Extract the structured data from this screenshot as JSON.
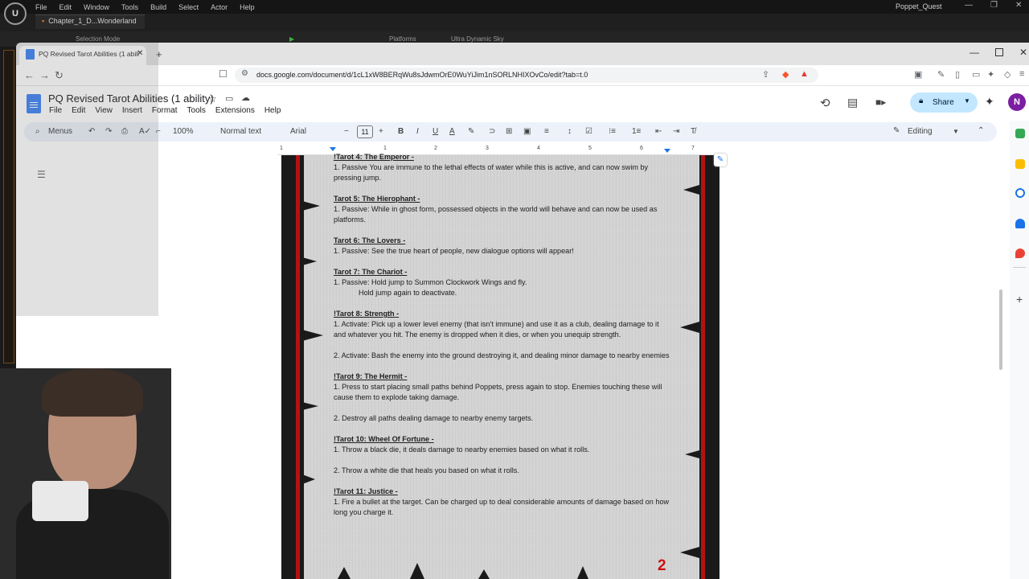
{
  "unreal": {
    "logo": "U",
    "menu": [
      "File",
      "Edit",
      "Window",
      "Tools",
      "Build",
      "Select",
      "Actor",
      "Help"
    ],
    "project_name": "Poppet_Quest",
    "level_tab": "Chapter_1_D...Wonderland",
    "toolbar": {
      "selection_mode": "Selection Mode",
      "platforms": "Platforms",
      "sky": "Ultra Dynamic Sky"
    }
  },
  "browser": {
    "tab_title": "PQ Revised Tarot Abilities (1 abili",
    "url": "docs.google.com/document/d/1cL1xW8BERqWu8sJdwmOrE0WuYiJim1nSORLNHIXOvCo/edit?tab=t.0"
  },
  "docs": {
    "title": "PQ Revised Tarot Abilities (1 ability)",
    "menu": [
      "File",
      "Edit",
      "View",
      "Insert",
      "Format",
      "Tools",
      "Extensions",
      "Help"
    ],
    "share_label": "Share",
    "avatar_letter": "N",
    "toolbar": {
      "menus": "Menus",
      "zoom": "100%",
      "style": "Normal text",
      "font": "Arial",
      "font_size": "11",
      "mode": "Editing"
    },
    "ruler": [
      "1",
      "1",
      "2",
      "3",
      "4",
      "5",
      "6",
      "7"
    ],
    "page_number": "2",
    "colors": {
      "share_bg": "#c2e7ff",
      "frame_red": "#b31212",
      "page_number": "#cc1111",
      "docs_blue": "#4285f4"
    }
  },
  "tarots": [
    {
      "header": "!Tarot 4: The Emperor -",
      "lines": [
        "1. Passive You are immune to the lethal effects of water while this is active, and can now swim by pressing jump."
      ]
    },
    {
      "header": "Tarot 5: The Hierophant -",
      "lines": [
        "1. Passive: While in ghost form, possessed objects in the world will behave and can now be used as platforms."
      ]
    },
    {
      "header": "Tarot 6: The Lovers -",
      "lines": [
        "1. Passive: See the true heart of people, new dialogue options will appear!"
      ]
    },
    {
      "header": "Tarot 7: The Chariot -",
      "lines": [
        "1. Passive: Hold jump to Summon Clockwork Wings and fly."
      ],
      "indented": "Hold jump again to deactivate."
    },
    {
      "header": "!Tarot 8: Strength -",
      "lines": [
        "1. Activate: Pick up a lower level enemy (that isn't immune) and use it as a club, dealing damage to it and whatever you hit. The enemy is dropped when it dies, or when you unequip strength.",
        "2. Activate: Bash the enemy into the ground destroying it, and dealing minor damage to nearby enemies"
      ]
    },
    {
      "header": "!Tarot 9: The Hermit -",
      "lines": [
        "1. Press to start placing small paths behind Poppets, press again to stop. Enemies touching these will cause them to explode taking damage.",
        "2. Destroy all paths dealing damage to nearby enemy targets."
      ]
    },
    {
      "header": "!Tarot 10: Wheel Of Fortune -",
      "lines": [
        "1. Throw a black die, it deals damage to nearby enemies based on what it rolls.",
        "2. Throw a white die that heals you based on what it rolls."
      ]
    },
    {
      "header": "!Tarot 11: Justice -",
      "lines": [
        "1. Fire a bullet at the target. Can be charged up to deal considerable amounts of damage based on how long you charge it."
      ]
    }
  ]
}
